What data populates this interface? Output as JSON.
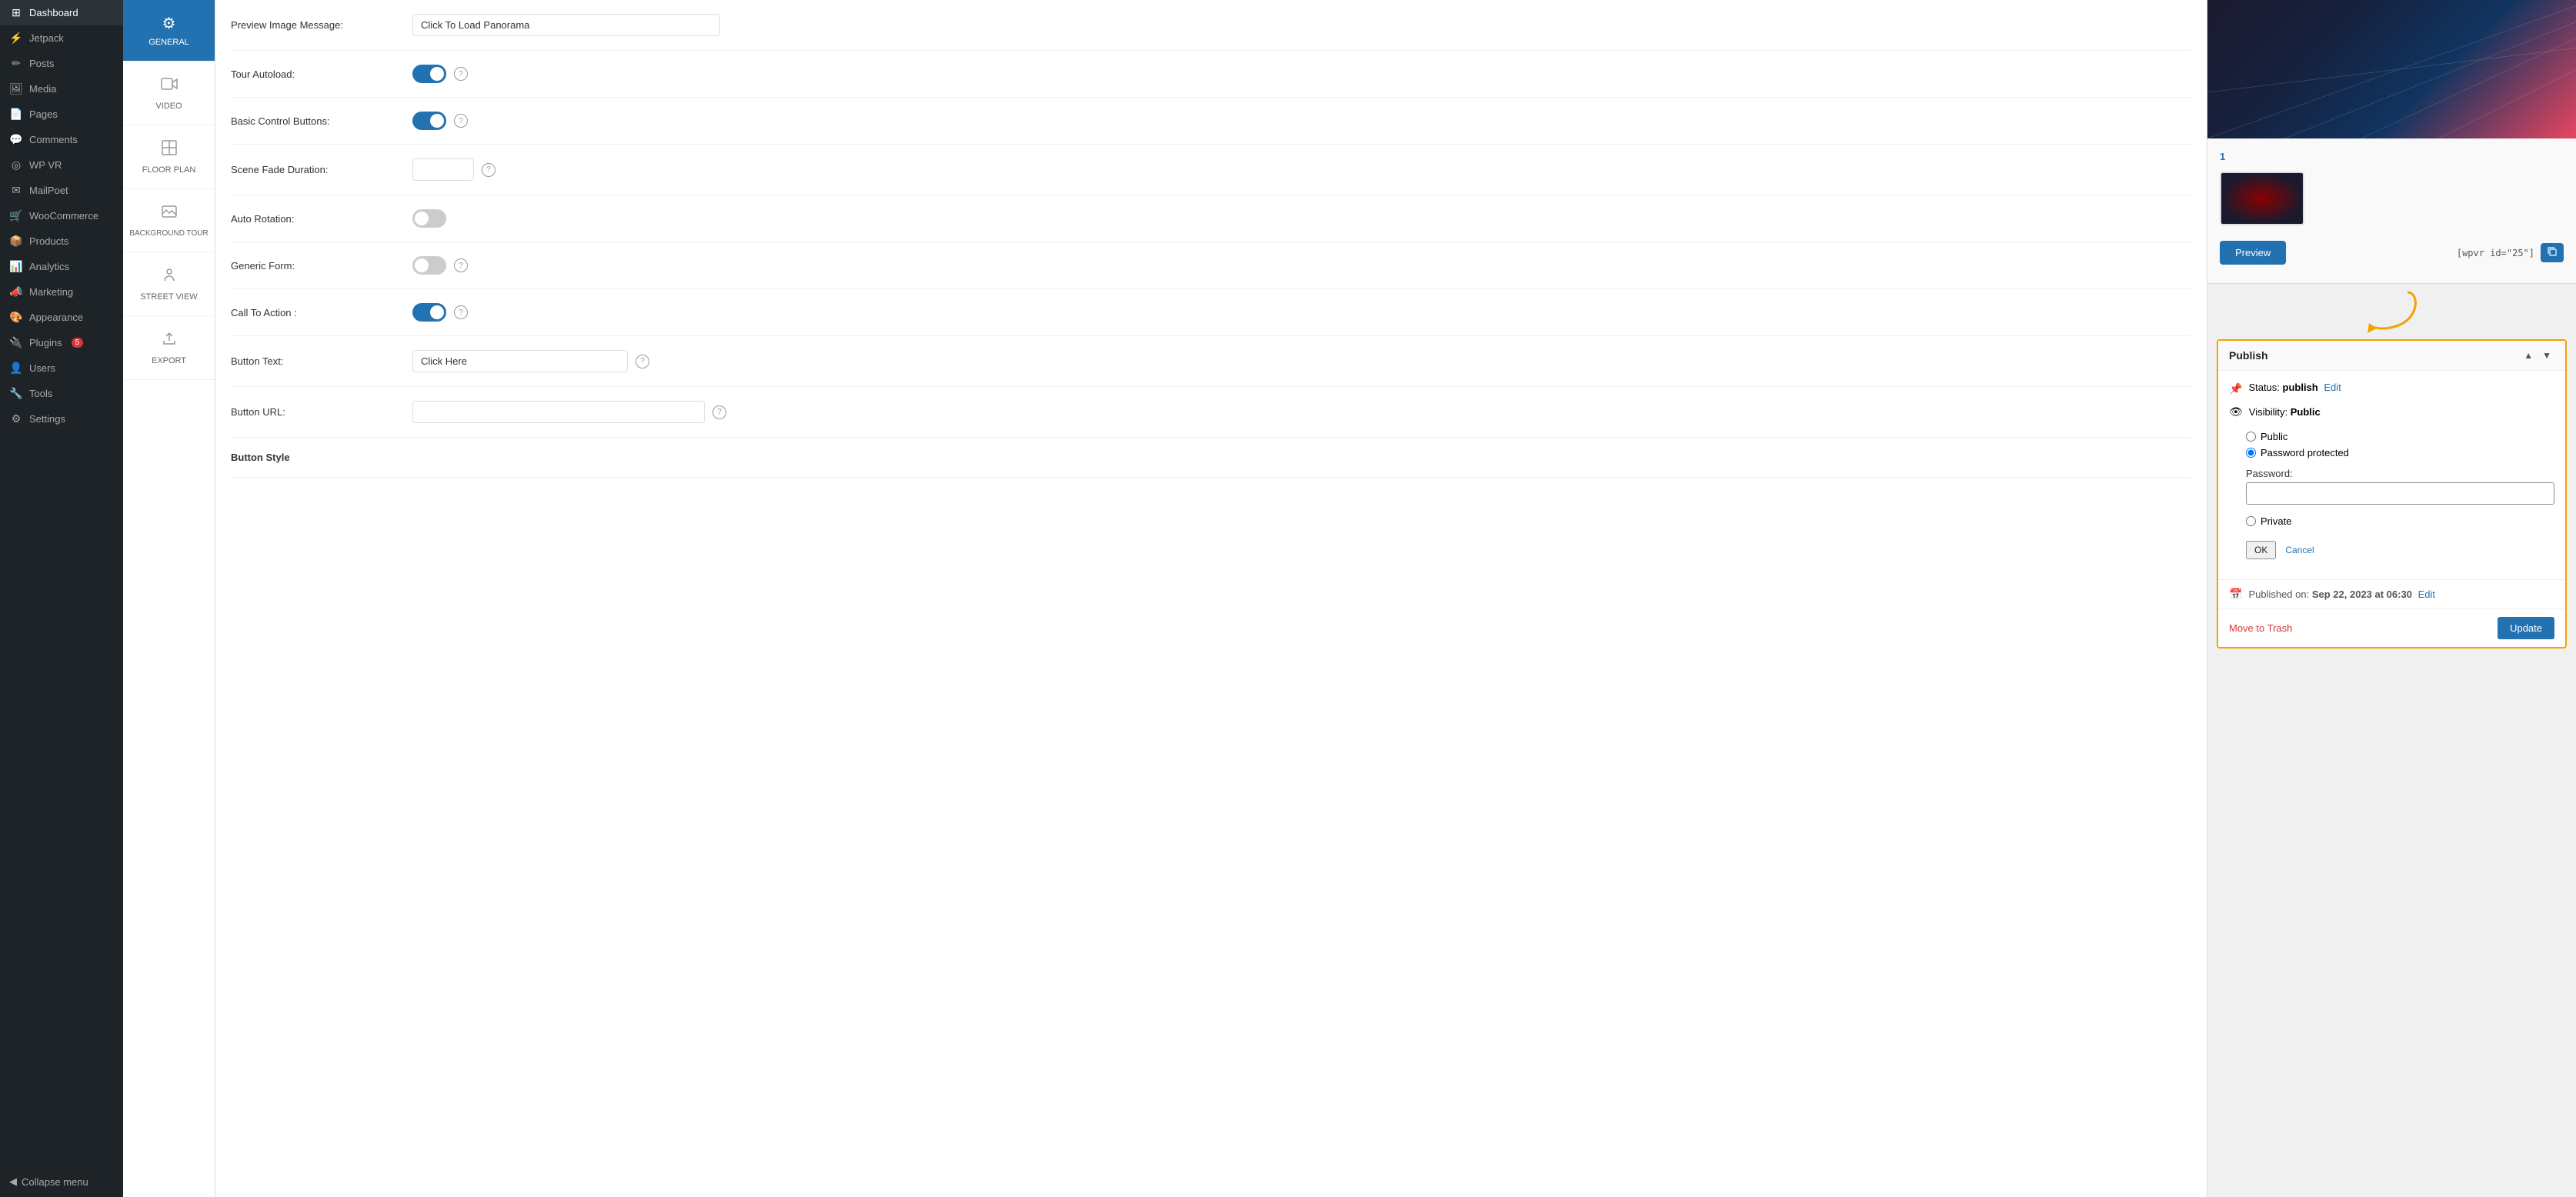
{
  "sidebar": {
    "items": [
      {
        "label": "Dashboard",
        "icon": "⊞"
      },
      {
        "label": "Jetpack",
        "icon": "⚡"
      },
      {
        "label": "Posts",
        "icon": "✏"
      },
      {
        "label": "Media",
        "icon": "🖼"
      },
      {
        "label": "Pages",
        "icon": "📄"
      },
      {
        "label": "Comments",
        "icon": "💬"
      },
      {
        "label": "WP VR",
        "icon": "◎"
      },
      {
        "label": "MailPoet",
        "icon": "✉"
      },
      {
        "label": "WooCommerce",
        "icon": "🛒"
      },
      {
        "label": "Products",
        "icon": "📦"
      },
      {
        "label": "Analytics",
        "icon": "📊"
      },
      {
        "label": "Marketing",
        "icon": "📣"
      },
      {
        "label": "Appearance",
        "icon": "🎨"
      },
      {
        "label": "Plugins",
        "icon": "🔌",
        "badge": "5"
      },
      {
        "label": "Users",
        "icon": "👤"
      },
      {
        "label": "Tools",
        "icon": "🔧"
      },
      {
        "label": "Settings",
        "icon": "⚙"
      }
    ],
    "collapse_label": "Collapse menu"
  },
  "sub_sidebar": {
    "items": [
      {
        "label": "GENERAL",
        "icon": "⚙",
        "active": true
      },
      {
        "label": "VIDEO",
        "icon": "🎬",
        "active": false
      },
      {
        "label": "FLOOR PLAN",
        "icon": "🗺",
        "active": false
      },
      {
        "label": "BACKGROUND TOUR",
        "icon": "🖼",
        "active": false
      },
      {
        "label": "STREET VIEW",
        "icon": "📍",
        "active": false
      },
      {
        "label": "EXPORT",
        "icon": "↗",
        "active": false
      }
    ]
  },
  "settings": {
    "fields": [
      {
        "id": "preview-image-message",
        "label": "Preview Image Message:",
        "type": "text",
        "value": "Click To Load Panorama",
        "wide": true
      },
      {
        "id": "tour-autoload",
        "label": "Tour Autoload:",
        "type": "toggle",
        "value": true
      },
      {
        "id": "basic-control-buttons",
        "label": "Basic Control Buttons:",
        "type": "toggle",
        "value": true
      },
      {
        "id": "scene-fade-duration",
        "label": "Scene Fade Duration:",
        "type": "text-small",
        "value": ""
      },
      {
        "id": "auto-rotation",
        "label": "Auto Rotation:",
        "type": "toggle",
        "value": false
      },
      {
        "id": "generic-form",
        "label": "Generic Form:",
        "type": "toggle",
        "value": false
      },
      {
        "id": "call-to-action",
        "label": "Call To Action :",
        "type": "toggle",
        "value": true
      },
      {
        "id": "button-text",
        "label": "Button Text:",
        "type": "text",
        "value": "Click Here"
      },
      {
        "id": "button-url",
        "label": "Button URL:",
        "type": "text",
        "value": "",
        "wide": true
      },
      {
        "id": "button-style",
        "label": "Button Style",
        "type": "section-header"
      }
    ]
  },
  "right_panel": {
    "thumbnail_count": "1",
    "preview_button_label": "Preview",
    "shortcode_text": "[wpvr id=\"25\"]",
    "publish_section": {
      "title": "Publish",
      "status_label": "Status:",
      "status_value": "publish",
      "edit_label": "Edit",
      "visibility_label": "Visibility:",
      "visibility_value": "Public",
      "radio_options": [
        "Public",
        "Password protected",
        "Private"
      ],
      "selected_radio": "Password protected",
      "password_label": "Password:",
      "password_value": "",
      "ok_label": "OK",
      "cancel_label": "Cancel",
      "published_on_label": "Published on:",
      "published_on_value": "Sep 22, 2023 at 06:30",
      "published_edit_label": "Edit",
      "move_to_trash_label": "Move to Trash",
      "update_label": "Update"
    },
    "arrow_label": "curved-arrow-down"
  }
}
